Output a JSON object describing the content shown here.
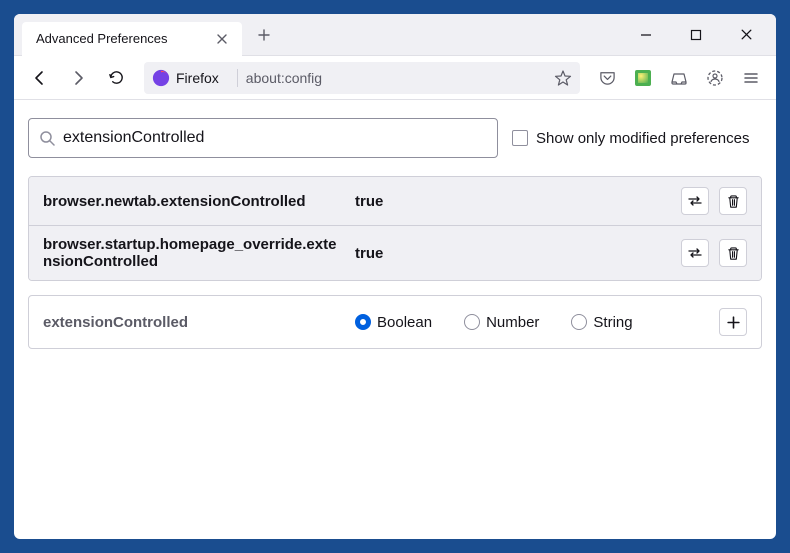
{
  "window": {
    "tab_title": "Advanced Preferences"
  },
  "urlbar": {
    "identity": "Firefox",
    "url": "about:config"
  },
  "search": {
    "value": "extensionControlled",
    "checkbox_label": "Show only modified preferences"
  },
  "prefs": [
    {
      "name": "browser.newtab.extensionControlled",
      "value": "true"
    },
    {
      "name": "browser.startup.homepage_override.extensionControlled",
      "value": "true"
    }
  ],
  "new_pref": {
    "name": "extensionControlled",
    "options": {
      "boolean": "Boolean",
      "number": "Number",
      "string": "String"
    }
  }
}
